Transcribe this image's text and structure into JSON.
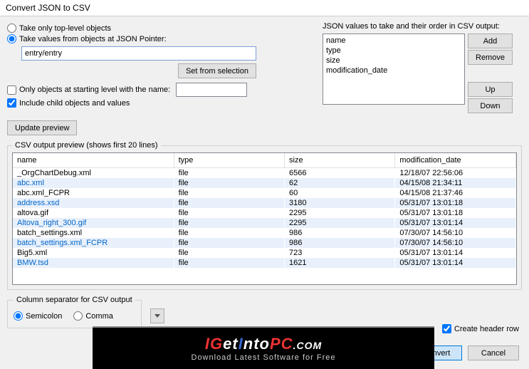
{
  "window": {
    "title": "Convert JSON to CSV"
  },
  "mode": {
    "top_level": "Take only top-level objects",
    "json_pointer": "Take values from objects at JSON Pointer:",
    "pointer_value": "entry/entry",
    "set_from_selection": "Set from selection",
    "only_starting_level": "Only objects at starting level with the name:",
    "include_children": "Include child objects and values"
  },
  "right": {
    "label": "JSON values to take and their order in CSV output:",
    "items": [
      "name",
      "type",
      "size",
      "modification_date"
    ],
    "add": "Add",
    "remove": "Remove",
    "up": "Up",
    "down": "Down"
  },
  "update_preview": "Update preview",
  "preview": {
    "legend": "CSV output preview (shows first 20 lines)",
    "headers": [
      "name",
      "type",
      "size",
      "modification_date"
    ],
    "rows": [
      {
        "name": "_OrgChartDebug.xml",
        "type": "file",
        "size": "6566",
        "mod": "12/18/07 22:56:06",
        "link": false
      },
      {
        "name": "abc.xml",
        "type": "file",
        "size": "62",
        "mod": "04/15/08 21:34:11",
        "link": true
      },
      {
        "name": "abc.xml_FCPR",
        "type": "file",
        "size": "60",
        "mod": "04/15/08 21:37:46",
        "link": false
      },
      {
        "name": "address.xsd",
        "type": "file",
        "size": "3180",
        "mod": "05/31/07 13:01:18",
        "link": true
      },
      {
        "name": "altova.gif",
        "type": "file",
        "size": "2295",
        "mod": "05/31/07 13:01:18",
        "link": false
      },
      {
        "name": "Altova_right_300.gif",
        "type": "file",
        "size": "2295",
        "mod": "05/31/07 13:01:14",
        "link": true
      },
      {
        "name": "batch_settings.xml",
        "type": "file",
        "size": "986",
        "mod": "07/30/07 14:56:10",
        "link": false
      },
      {
        "name": "batch_settings.xml_FCPR",
        "type": "file",
        "size": "986",
        "mod": "07/30/07 14:56:10",
        "link": true
      },
      {
        "name": "Big5.xml",
        "type": "file",
        "size": "723",
        "mod": "05/31/07 13:01:14",
        "link": false
      },
      {
        "name": "BMW.tsd",
        "type": "file",
        "size": "1621",
        "mod": "05/31/07 13:01:14",
        "link": true
      }
    ]
  },
  "separator": {
    "legend": "Column separator for CSV output",
    "semicolon": "Semicolon",
    "comma": "Comma"
  },
  "create_header": "Create header row",
  "convert": "Convert",
  "cancel": "Cancel",
  "banner": {
    "title_pre": "IG",
    "title_mid1": "et",
    "title_mid2": "I",
    "title_mid3": "nto",
    "title_end": "PC",
    "title_suffix": ".COM",
    "sub": "Download Latest Software for Free"
  }
}
